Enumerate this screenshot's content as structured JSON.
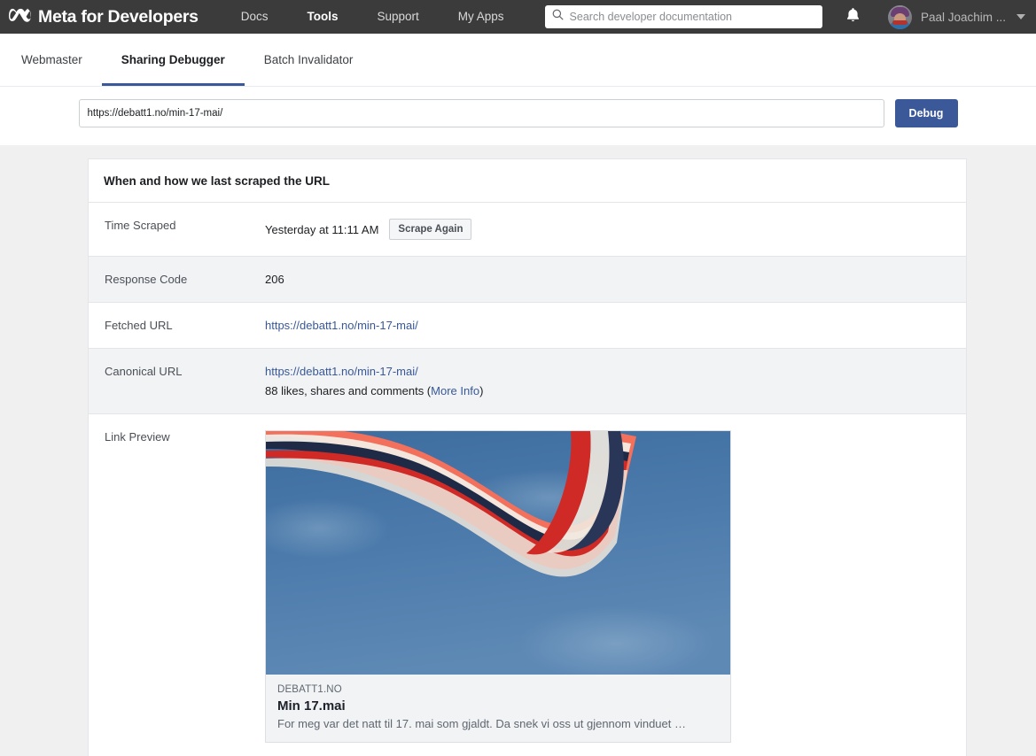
{
  "topnav": {
    "brand": "Meta for Developers",
    "brand_icon": "meta-infinity-logo",
    "links": [
      {
        "label": "Docs",
        "active": false
      },
      {
        "label": "Tools",
        "active": true
      },
      {
        "label": "Support",
        "active": false
      },
      {
        "label": "My Apps",
        "active": false
      }
    ],
    "search": {
      "placeholder": "Search developer documentation",
      "value": "",
      "icon": "search-icon"
    },
    "notifications_icon": "bell-icon",
    "user": {
      "name": "Paal Joachim ...",
      "avatar": "user-avatar-photo",
      "caret": "chevron-down-icon"
    },
    "bg_color": "#3b3b3b"
  },
  "tabs": [
    {
      "label": "Webmaster",
      "active": false
    },
    {
      "label": "Sharing Debugger",
      "active": true
    },
    {
      "label": "Batch Invalidator",
      "active": false
    }
  ],
  "urlbar": {
    "input_value": "https://debatt1.no/min-17-mai/",
    "input_placeholder": "Enter a URL",
    "debug_label": "Debug",
    "accent_color": "#3b5998"
  },
  "card": {
    "header": "When and how we last scraped the URL",
    "rows": [
      {
        "label": "Time Scraped",
        "value": "Yesterday at 11:11 AM",
        "button": "Scrape Again",
        "shaded": false
      },
      {
        "label": "Response Code",
        "value": "206",
        "shaded": true
      },
      {
        "label": "Fetched URL",
        "value": "https://debatt1.no/min-17-mai/",
        "shaded": false
      },
      {
        "label": "Canonical URL",
        "value": "https://debatt1.no/min-17-mai/",
        "extra_prefix": "88 likes, shares and comments (",
        "extra_link": "More Info",
        "extra_suffix": ")",
        "shaded": true
      }
    ],
    "preview_row": {
      "label": "Link Preview",
      "image_alt": "norwegian-flag-against-blue-sky",
      "domain": "DEBATT1.NO",
      "title": "Min 17.mai",
      "description": "For meg var det natt til 17. mai som gjaldt. Da snek vi oss ut gjennom vinduet …"
    }
  },
  "colors": {
    "page_bg": "#f0f0f0",
    "card_bg": "#ffffff",
    "row_shaded": "#f2f3f5",
    "link": "#385898",
    "border": "#e3e5e8"
  }
}
